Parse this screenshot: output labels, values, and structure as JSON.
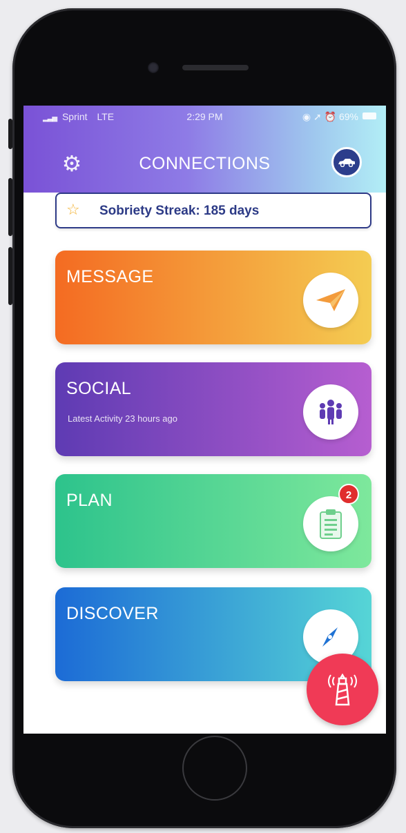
{
  "status_bar": {
    "carrier": "Sprint",
    "network": "LTE",
    "time": "2:29 PM",
    "battery": "69%"
  },
  "header": {
    "title": "CONNECTIONS",
    "settings_icon": "gear-icon",
    "profile_icon": "car-icon"
  },
  "streak": {
    "icon": "star-icon",
    "label": "Sobriety Streak: 185 days"
  },
  "cards": [
    {
      "title": "MESSAGE",
      "subtitle": "",
      "icon": "paper-plane-icon",
      "gradient": [
        "#f46b22",
        "#f4cc52"
      ]
    },
    {
      "title": "SOCIAL",
      "subtitle": "Latest Activity 23 hours ago",
      "icon": "group-icon",
      "gradient": [
        "#5e3bb3",
        "#b65ed0"
      ]
    },
    {
      "title": "PLAN",
      "subtitle": "",
      "icon": "clipboard-icon",
      "badge": "2",
      "gradient": [
        "#2dc38c",
        "#7ee89c"
      ]
    },
    {
      "title": "DISCOVER",
      "subtitle": "",
      "icon": "compass-icon",
      "gradient": [
        "#1c6bd6",
        "#56d5d6"
      ]
    }
  ],
  "fab": {
    "icon": "lighthouse-icon",
    "color": "#f03a56"
  },
  "colors": {
    "accent": "#2c3a86",
    "badge": "#e02d2d"
  }
}
